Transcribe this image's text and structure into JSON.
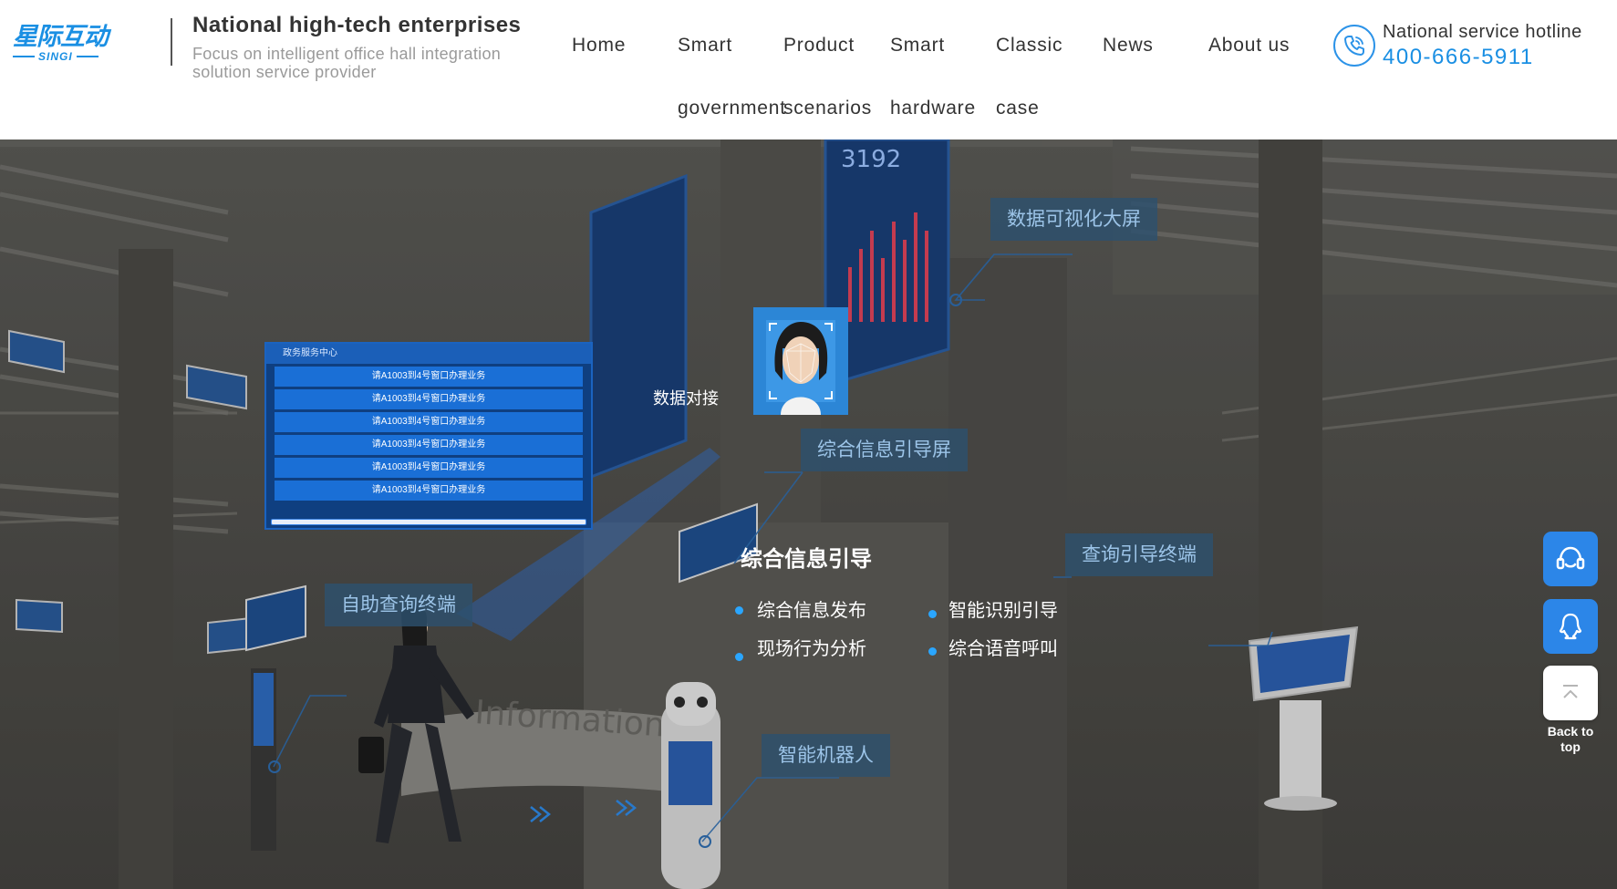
{
  "brand": {
    "logo_cn": "星际互动",
    "logo_en": "SINGI",
    "tagline_title": "National high-tech enterprises",
    "tagline_sub": "Focus on intelligent office hall integration solution service provider"
  },
  "nav": {
    "home": "Home",
    "smart_line1": "Smart",
    "smart_line2": "government",
    "product_line1": "Product",
    "product_line2": "scenarios",
    "hardware_line1": "Smart",
    "hardware_line2": "hardware",
    "case_line1": "Classic",
    "case_line2": "case",
    "news": "News",
    "about": "About us"
  },
  "hotline": {
    "label": "National service hotline",
    "number": "400-666-5911",
    "icon": "phone-icon"
  },
  "hero": {
    "screen_panel": {
      "title": "政务服务中心",
      "rows": [
        "请A1003到4号窗口办理业务",
        "请A1003到4号窗口办理业务",
        "请A1003到4号窗口办理业务",
        "请A1003到4号窗口办理业务",
        "请A1003到4号窗口办理业务",
        "请A1003到4号窗口办理业务"
      ]
    },
    "wall_screen_number": "3192",
    "data_label": "数据对接",
    "callouts": {
      "data_screen": "数据可视化大屏",
      "info_screen": "综合信息引导屏",
      "query_terminal": "查询引导终端",
      "robot": "智能机器人",
      "self_service": "自助查询终端"
    },
    "info_title": "综合信息引导",
    "bullets": [
      "综合信息发布",
      "智能识别引导",
      "现场行为分析",
      "综合语音呼叫"
    ],
    "floor_text": "Information",
    "colors": {
      "accent": "#1a8fe3",
      "panel_blue": "#1a6fd6",
      "callout_bg": "#2d506e",
      "callout_text": "#9cc4e8"
    }
  },
  "side_buttons": {
    "service_icon": "headset-icon",
    "qq_icon": "qq-icon",
    "top_icon": "arrow-up-icon",
    "back_to_top": "Back to top"
  }
}
